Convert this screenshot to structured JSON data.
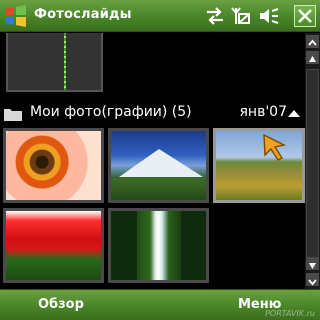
{
  "titlebar": {
    "title": "Фотослайды",
    "icons": [
      "windows-start-icon",
      "sync-arrows-icon",
      "antenna-off-icon",
      "speaker-muted-icon",
      "close-icon"
    ]
  },
  "group": {
    "title": "Мои фото(графии) (5)",
    "date": "янв'07"
  },
  "photos": [
    {
      "subject": "flower"
    },
    {
      "subject": "mountain"
    },
    {
      "subject": "meadow"
    },
    {
      "subject": "tulips"
    },
    {
      "subject": "waterfall"
    }
  ],
  "softkeys": {
    "left": "Обзор",
    "right": "Меню"
  },
  "watermark": "PORTAVIK.ru",
  "colors": {
    "bar_green": "#4e8a2c",
    "selection_border": "#9a9a9a",
    "background": "#000000"
  }
}
